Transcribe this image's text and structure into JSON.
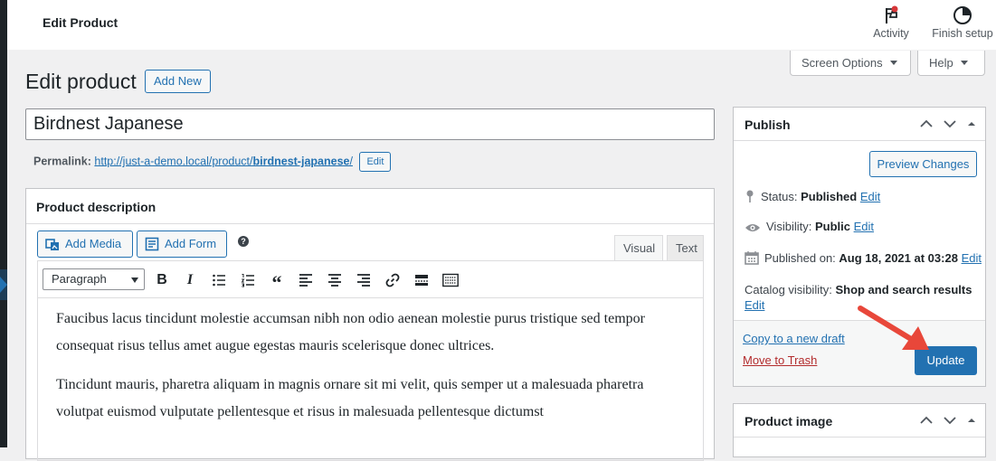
{
  "topbar": {
    "title": "Edit Product",
    "activity_label": "Activity",
    "finish_setup_label": "Finish setup"
  },
  "screen_options_label": "Screen Options",
  "help_label": "Help",
  "page": {
    "heading": "Edit product",
    "add_new_label": "Add New",
    "product_title": "Birdnest Japanese",
    "permalink_label": "Permalink:",
    "permalink_base": "http://just-a-demo.local/product/",
    "permalink_slug": "birdnest-japanese",
    "permalink_suffix": "/",
    "permalink_edit_label": "Edit"
  },
  "description": {
    "heading": "Product description",
    "add_media_label": "Add Media",
    "add_form_label": "Add Form",
    "tab_visual": "Visual",
    "tab_text": "Text",
    "format_select": "Paragraph",
    "paragraph_1": "Faucibus lacus tincidunt molestie accumsan nibh non odio aenean molestie purus tristique sed tempor consequat risus tellus amet augue egestas mauris scelerisque donec ultrices.",
    "paragraph_2": "Tincidunt mauris, pharetra aliquam in magnis ornare sit mi velit, quis semper ut a malesuada pharetra volutpat euismod vulputate pellentesque et risus in malesuada pellentesque dictumst"
  },
  "publish": {
    "heading": "Publish",
    "preview_label": "Preview Changes",
    "status_label": "Status:",
    "status_value": "Published",
    "visibility_label": "Visibility:",
    "visibility_value": "Public",
    "published_on_label": "Published on:",
    "published_on_value": "Aug 18, 2021 at 03:28",
    "catalog_label": "Catalog visibility:",
    "catalog_value": "Shop and search results",
    "edit_label": "Edit",
    "copy_draft_label": "Copy to a new draft",
    "trash_label": "Move to Trash",
    "update_label": "Update"
  },
  "product_image": {
    "heading": "Product image"
  },
  "colors": {
    "accent": "#2271b1",
    "trash": "#b32d2e",
    "annotation_arrow": "#e8473a"
  }
}
